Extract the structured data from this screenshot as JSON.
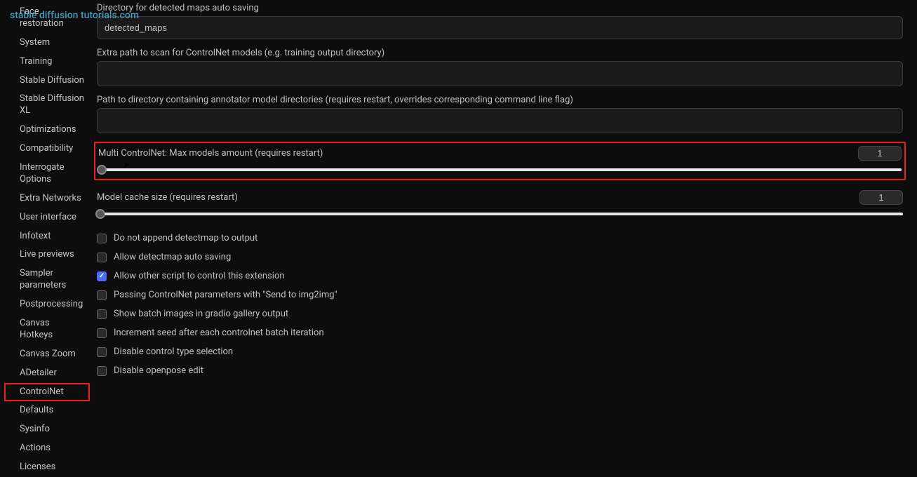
{
  "watermark": "stable diffusion tutorials.com",
  "sidebar": {
    "items": [
      {
        "label": "Face restoration"
      },
      {
        "label": "System"
      },
      {
        "label": "Training"
      },
      {
        "label": "Stable Diffusion"
      },
      {
        "label": "Stable Diffusion XL"
      },
      {
        "label": "Optimizations"
      },
      {
        "label": "Compatibility"
      },
      {
        "label": "Interrogate Options"
      },
      {
        "label": "Extra Networks"
      },
      {
        "label": "User interface"
      },
      {
        "label": "Infotext"
      },
      {
        "label": "Live previews"
      },
      {
        "label": "Sampler parameters"
      },
      {
        "label": "Postprocessing"
      },
      {
        "label": "Canvas Hotkeys"
      },
      {
        "label": "Canvas Zoom"
      },
      {
        "label": "ADetailer"
      },
      {
        "label": "ControlNet"
      },
      {
        "label": "Defaults"
      },
      {
        "label": "Sysinfo"
      },
      {
        "label": "Actions"
      },
      {
        "label": "Licenses"
      }
    ],
    "active_index": 17
  },
  "fields": {
    "detected_maps_label": "Directory for detected maps auto saving",
    "detected_maps_value": "detected_maps",
    "extra_path_label": "Extra path to scan for ControlNet models (e.g. training output directory)",
    "extra_path_value": "",
    "annotator_path_label": "Path to directory containing annotator model directories (requires restart, overrides corresponding command line flag)",
    "annotator_path_value": ""
  },
  "sliders": {
    "multi_controlnet": {
      "label": "Multi ControlNet: Max models amount (requires restart)",
      "value": "1"
    },
    "model_cache": {
      "label": "Model cache size (requires restart)",
      "value": "1"
    }
  },
  "checkboxes": {
    "no_append": {
      "label": "Do not append detectmap to output",
      "checked": false
    },
    "allow_autosave": {
      "label": "Allow detectmap auto saving",
      "checked": false
    },
    "allow_script": {
      "label": "Allow other script to control this extension",
      "checked": true
    },
    "passing_params": {
      "label": "Passing ControlNet parameters with \"Send to img2img\"",
      "checked": false
    },
    "show_batch": {
      "label": "Show batch images in gradio gallery output",
      "checked": false
    },
    "increment_seed": {
      "label": "Increment seed after each controlnet batch iteration",
      "checked": false
    },
    "disable_control_type": {
      "label": "Disable control type selection",
      "checked": false
    },
    "disable_openpose": {
      "label": "Disable openpose edit",
      "checked": false
    }
  }
}
